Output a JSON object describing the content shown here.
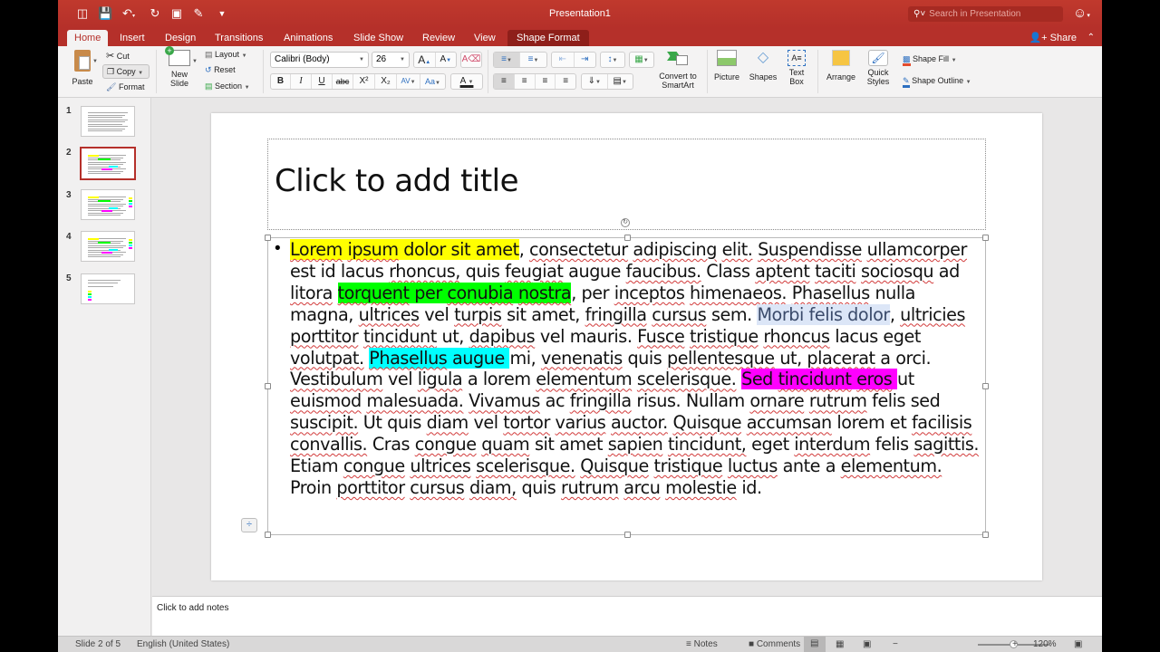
{
  "titlebar": {
    "doc_title": "Presentation1",
    "search_placeholder": "Search in Presentation",
    "quick_access": [
      "sidebar-icon",
      "save-icon",
      "undo-icon",
      "redo-icon",
      "slideshow-icon",
      "review-icon",
      "customize-icon"
    ]
  },
  "tabs": [
    {
      "label": "Home",
      "active": true
    },
    {
      "label": "Insert"
    },
    {
      "label": "Design"
    },
    {
      "label": "Transitions"
    },
    {
      "label": "Animations"
    },
    {
      "label": "Slide Show"
    },
    {
      "label": "Review"
    },
    {
      "label": "View"
    },
    {
      "label": "Shape Format",
      "contextual": true
    }
  ],
  "share_label": "Share",
  "ribbon": {
    "paste": "Paste",
    "cut": "Cut",
    "copy": "Copy",
    "format": "Format",
    "new_slide": [
      "New",
      "Slide"
    ],
    "layout": "Layout",
    "reset": "Reset",
    "section": "Section",
    "font_name": "Calibri (Body)",
    "font_size": "26",
    "grow_font": "A",
    "shrink_font": "A",
    "bold": "B",
    "italic": "I",
    "underline": "U",
    "strike": "abc",
    "superscript": "X²",
    "subscript": "X₂",
    "convert_smartart": [
      "Convert to",
      "SmartArt"
    ],
    "picture": "Picture",
    "shapes": "Shapes",
    "text_box": [
      "Text",
      "Box"
    ],
    "arrange": "Arrange",
    "quick_styles": [
      "Quick",
      "Styles"
    ],
    "shape_fill": "Shape Fill",
    "shape_outline": "Shape Outline"
  },
  "thumbnails": [
    {
      "num": "1",
      "style": "text"
    },
    {
      "num": "2",
      "style": "highlight",
      "selected": true
    },
    {
      "num": "3",
      "style": "highlight-swatch"
    },
    {
      "num": "4",
      "style": "highlight-swatch"
    },
    {
      "num": "5",
      "style": "instructions"
    }
  ],
  "slide": {
    "title_placeholder": "Click to add title",
    "highlight_colors": {
      "yellow": "#ffff00",
      "green": "#00ff00",
      "selection": "#dce6f7",
      "cyan": "#00ffff",
      "magenta": "#ff00ff"
    },
    "body_segments": [
      {
        "t": "Lorem ipsum dolor sit amet",
        "hl": "yellow"
      },
      {
        "t": ", consectetur adipiscing elit. Suspendisse ullamcorper est id lacus rhoncus, quis feugiat augue faucibus. Class aptent taciti sociosqu ad litora "
      },
      {
        "t": "torquent per conubia nostra",
        "hl": "green"
      },
      {
        "t": ", per inceptos himenaeos. Phasellus nulla magna, ultrices vel turpis sit amet, fringilla cursus sem. "
      },
      {
        "t": "Morbi felis dolor",
        "hl": "selection"
      },
      {
        "t": ", ultricies porttitor tincidunt ut, dapibus vel mauris. Fusce tristique rhoncus lacus eget volutpat. "
      },
      {
        "t": "Phasellus augue ",
        "hl": "cyan"
      },
      {
        "t": "mi, venenatis quis pellentesque ut, placerat a orci. Vestibulum vel ligula a lorem elementum scelerisque. "
      },
      {
        "t": "Sed tincidunt eros ",
        "hl": "magenta"
      },
      {
        "t": "ut euismod malesuada. Vivamus ac fringilla risus. Nullam ornare rutrum felis sed suscipit. Ut quis diam vel tortor varius auctor. Quisque accumsan lorem et facilisis convallis. Cras congue quam sit amet sapien tincidunt, eget interdum felis sagittis. Etiam congue ultrices scelerisque. Quisque tristique luctus ante a elementum. Proin porttitor cursus diam, quis rutrum arcu molestie id."
      }
    ]
  },
  "notes_placeholder": "Click to add notes",
  "status": {
    "slide_pos": "Slide 2 of 5",
    "language": "English (United States)",
    "notes": "Notes",
    "comments": "Comments",
    "zoom": "120%",
    "zoom_fraction": 0.5
  },
  "accent": "#b5302a"
}
